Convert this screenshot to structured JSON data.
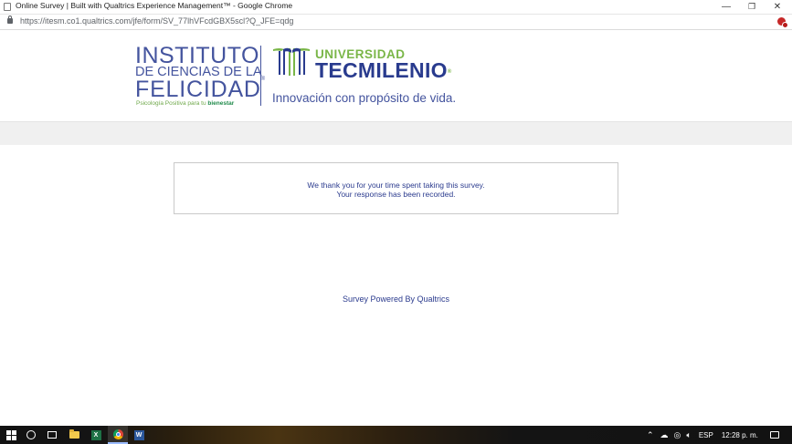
{
  "window": {
    "title": "Online Survey | Built with Qualtrics Experience Management™ - Google Chrome",
    "minimize_glyph": "—",
    "restore_glyph": "❐",
    "close_glyph": "✕"
  },
  "address_bar": {
    "url": "https://itesm.co1.qualtrics.com/jfe/form/SV_77lhVFcdGBX5scl?Q_JFE=qdg"
  },
  "header": {
    "left_logo": {
      "line1": "INSTITUTO",
      "line2": "DE CIENCIAS DE LA",
      "line3": "FELICIDAD",
      "registered": "®",
      "tagline_prefix": "Psicología Positiva para tu ",
      "tagline_bold": "bienestar"
    },
    "right_logo": {
      "line1": "UNIVERSIDAD",
      "line2": "TECMILENIO",
      "registered": "®",
      "slogan": "Innovación con propósito de vida."
    }
  },
  "message": {
    "line1": "We thank you for your time spent taking this survey.",
    "line2": "Your response has been recorded."
  },
  "footer": {
    "powered_by": "Survey Powered By Qualtrics"
  },
  "taskbar": {
    "language": "ESP",
    "clock": "12:28 p. m.",
    "excel_letter": "X",
    "word_letter": "W"
  },
  "colors": {
    "brand_blue": "#44549e",
    "tecmilenio_navy": "#293b8e",
    "tecmilenio_green": "#7ab648",
    "message_text": "#2b3b8e"
  }
}
